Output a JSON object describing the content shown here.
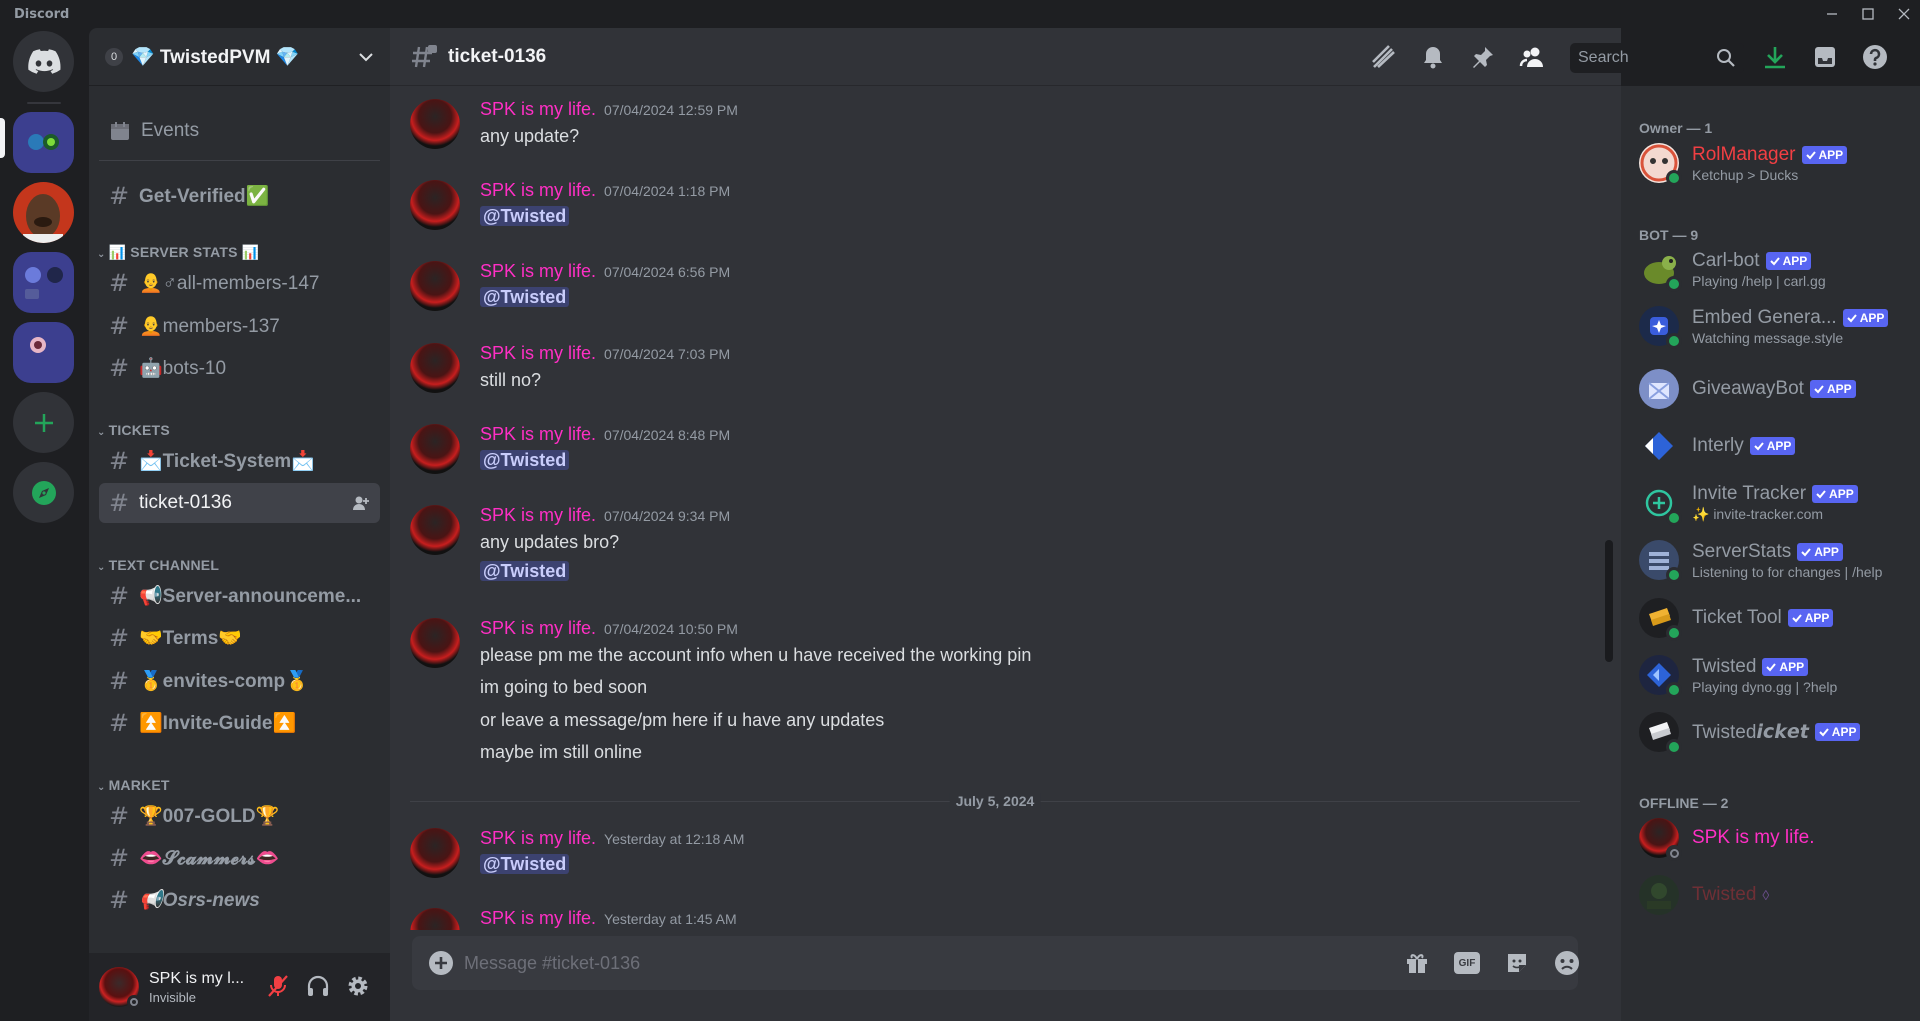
{
  "titlebar": {
    "app_name": "Discord"
  },
  "servers": [
    {
      "name": "home"
    },
    {
      "name": "server-1"
    },
    {
      "name": "server-2"
    },
    {
      "name": "server-3"
    },
    {
      "name": "server-4"
    }
  ],
  "guild": {
    "level": "0",
    "name": "💎 TwistedPVM 💎"
  },
  "sidebar": {
    "events_label": "Events",
    "top_channels": [
      {
        "label": "Get-Verified✅"
      }
    ],
    "categories": {
      "server_stats": "📊 SERVER STATS 📊",
      "tickets": "TICKETS",
      "text_channel": "TEXT CHANNEL",
      "market": "MARKET"
    },
    "stats_channels": [
      {
        "label": "🧑‍🦲♂all-members-147"
      },
      {
        "label": "🧑‍🦲members-137"
      },
      {
        "label": "🤖bots-10"
      }
    ],
    "ticket_channels": [
      {
        "label": "📩Ticket-System📩"
      },
      {
        "label": "ticket-0136"
      }
    ],
    "text_channels": [
      {
        "label": "📢Server-announceme..."
      },
      {
        "label": "🤝Terms🤝"
      },
      {
        "label": "🥇envites-comp🥇"
      },
      {
        "label": "⏫Invite-Guide⏫"
      }
    ],
    "market_channels": [
      {
        "label": "🏆007-GOLD🏆"
      },
      {
        "label": "👄𝓢𝓬𝓪𝓶𝓶𝓮𝓻𝓼👄"
      },
      {
        "label": "📢Osrs-news"
      }
    ]
  },
  "user": {
    "name": "SPK is my l...",
    "status": "Invisible"
  },
  "channel": {
    "name": "ticket-0136",
    "search_placeholder": "Search"
  },
  "messages": [
    {
      "author": "SPK is my life.",
      "time": "07/04/2024 12:59 PM",
      "lines": [
        "any update?"
      ]
    },
    {
      "author": "SPK is my life.",
      "time": "07/04/2024 1:18 PM",
      "mention": "@Twisted"
    },
    {
      "author": "SPK is my life.",
      "time": "07/04/2024 6:56 PM",
      "mention": "@Twisted"
    },
    {
      "author": "SPK is my life.",
      "time": "07/04/2024 7:03 PM",
      "lines": [
        "still no?"
      ]
    },
    {
      "author": "SPK is my life.",
      "time": "07/04/2024 8:48 PM",
      "mention": "@Twisted"
    },
    {
      "author": "SPK is my life.",
      "time": "07/04/2024 9:34 PM",
      "lines": [
        "any updates bro?"
      ],
      "mention": "@Twisted"
    },
    {
      "author": "SPK is my life.",
      "time": "07/04/2024 10:50 PM",
      "lines": [
        "please pm me the account info when u have received the working pin",
        "im going to bed soon",
        "or leave a message/pm here if u have any updates",
        "maybe im still online"
      ]
    },
    {
      "author": "SPK is my life.",
      "time": "Yesterday at 12:18 AM",
      "mention": "@Twisted"
    },
    {
      "author": "SPK is my life.",
      "time": "Yesterday at 1:45 AM"
    }
  ],
  "date_divider": "July 5, 2024",
  "composer": {
    "placeholder": "Message #ticket-0136",
    "gif_label": "GIF"
  },
  "members": {
    "owner_header": "Owner — 1",
    "bot_header": "BOT — 9",
    "offline_header": "OFFLINE — 2",
    "app_badge": "APP",
    "owner": [
      {
        "name": "RolManager",
        "activity": "Ketchup > Ducks",
        "color": "#f23f43"
      }
    ],
    "bots": [
      {
        "name": "Carl-bot",
        "activity": "Playing /help | carl.gg"
      },
      {
        "name": "Embed Genera...",
        "activity": "Watching message.style"
      },
      {
        "name": "GiveawayBot",
        "activity": ""
      },
      {
        "name": "Interly",
        "activity": ""
      },
      {
        "name": "Invite Tracker",
        "activity": "✨ invite-tracker.com"
      },
      {
        "name": "ServerStats",
        "activity": "Listening to for changes | /help"
      },
      {
        "name": "Ticket Tool",
        "activity": ""
      },
      {
        "name": "Twisted",
        "activity": "Playing dyno.gg | ?help"
      },
      {
        "name": "Twisted𝙞𝙘𝙠𝙚𝙩",
        "activity": ""
      }
    ],
    "offline": [
      {
        "name": "SPK is my life.",
        "color": "#ff2fc5"
      },
      {
        "name": "Twisted",
        "color": "#6b1f24"
      }
    ]
  },
  "colors": {
    "mention_bg": "#3c4270",
    "author": "#ff2fc5",
    "accent": "#5865f2",
    "online": "#23a55a",
    "download": "#23a55a"
  }
}
